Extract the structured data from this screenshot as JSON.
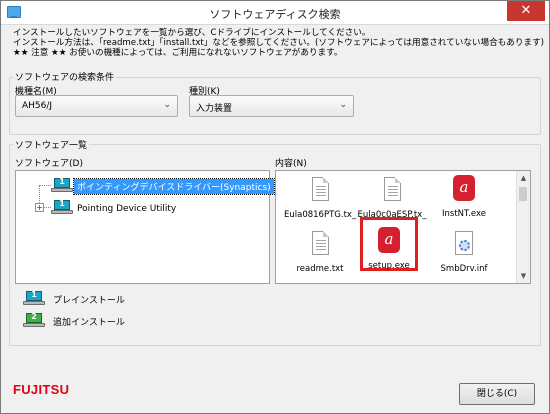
{
  "window": {
    "title": "ソフトウェアディスク検索",
    "close_glyph": "✕"
  },
  "intro": {
    "line1": "インストールしたいソフトウェアを一覧から選び、Cドライブにインストールしてください。",
    "line2": "インストール方法は、「readme.txt」「install.txt」などを参照してください。(ソフトウェアによっては用意されていない場合もあります)",
    "line3": "★★ 注意 ★★ お使いの機種によっては、ご利用になれないソフトウェアがあります。"
  },
  "search": {
    "group_title": "ソフトウェアの検索条件",
    "model_label": "機種名(M)",
    "model_value": "AH56/J",
    "type_label": "種別(K)",
    "type_value": "入力装置"
  },
  "list": {
    "group_title": "ソフトウェア一覧",
    "software_label": "ソフトウェア(D)",
    "contents_label": "内容(N)",
    "tree": [
      {
        "label": "ポインティングデバイスドライバー(Synaptics)",
        "badge": "1",
        "selected": true
      },
      {
        "label": "Pointing Device Utility",
        "badge": "1",
        "selected": false
      }
    ],
    "tree_expander": "+",
    "files": [
      {
        "name": "Eula0816PTG.tx_",
        "icon": "text-file-icon"
      },
      {
        "name": "Eula0c0aESP.tx_",
        "icon": "text-file-icon"
      },
      {
        "name": "InstNT.exe",
        "icon": "installer-icon"
      },
      {
        "name": "readme.txt",
        "icon": "text-file-icon"
      },
      {
        "name": "setup.exe",
        "icon": "installer-icon",
        "highlighted": true
      },
      {
        "name": "SmbDrv.inf",
        "icon": "settings-file-icon"
      }
    ],
    "scroll_up": "▲",
    "scroll_down": "▼"
  },
  "legend": {
    "preinstall_badge": "1",
    "preinstall": "プレインストール",
    "addinstall_badge": "2",
    "addinstall": "追加インストール"
  },
  "footer": {
    "brand": "FUJITSU",
    "close_button": "閉じる(C)"
  },
  "colors": {
    "selection": "#3399ff",
    "highlight_box": "#e02020",
    "brand": "#e60012",
    "close_button": "#c7372f"
  }
}
